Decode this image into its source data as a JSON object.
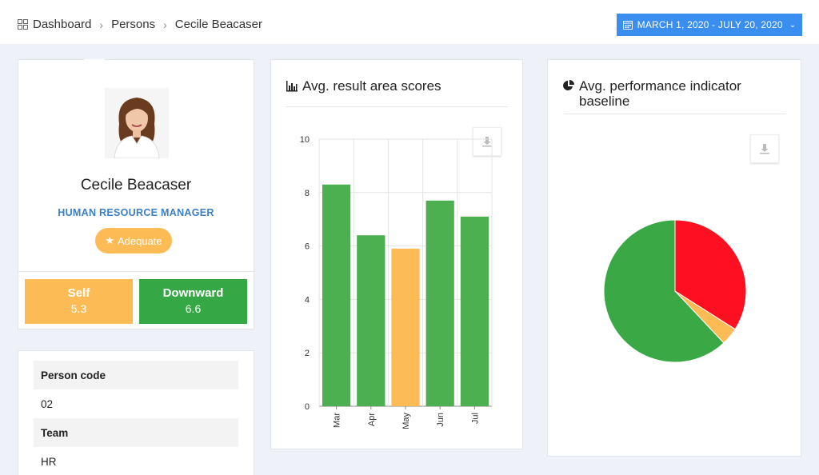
{
  "breadcrumb": {
    "items": [
      "Dashboard",
      "Persons",
      "Cecile Beacaser"
    ]
  },
  "date_range": {
    "label": "MARCH 1, 2020 - JULY 20, 2020"
  },
  "profile": {
    "name": "Cecile Beacaser",
    "role": "HUMAN RESOURCE MANAGER",
    "badge": "Adequate",
    "scores": [
      {
        "label": "Self",
        "value": "5.3"
      },
      {
        "label": "Downward",
        "value": "6.6"
      }
    ]
  },
  "info": {
    "fields": [
      {
        "label": "Person code",
        "value": "02"
      },
      {
        "label": "Team",
        "value": "HR"
      }
    ]
  },
  "bar_card": {
    "title": "Avg. result area scores"
  },
  "pie_card": {
    "title": "Avg. performance indicator baseline"
  },
  "colors": {
    "green": "#4caf50",
    "orange": "#fdbb55",
    "red": "#ff0f1f",
    "accent": "#3a8ef0",
    "role": "#3b7fc4"
  },
  "chart_data": [
    {
      "type": "bar",
      "title": "Avg. result area scores",
      "categories": [
        "Mar",
        "Apr",
        "May",
        "Jun",
        "Jul"
      ],
      "values": [
        8.3,
        6.4,
        5.9,
        7.7,
        7.1
      ],
      "bar_colors": [
        "#4caf50",
        "#4caf50",
        "#fdbb55",
        "#4caf50",
        "#4caf50"
      ],
      "ylim": [
        0,
        10
      ],
      "yticks": [
        0,
        2,
        4,
        6,
        8,
        10
      ],
      "grid": true
    },
    {
      "type": "pie",
      "title": "Avg. performance indicator baseline",
      "slices": [
        {
          "value": 34,
          "color": "#ff0f1f"
        },
        {
          "value": 4,
          "color": "#fdbb55"
        },
        {
          "value": 62,
          "color": "#3aa845"
        }
      ]
    }
  ]
}
